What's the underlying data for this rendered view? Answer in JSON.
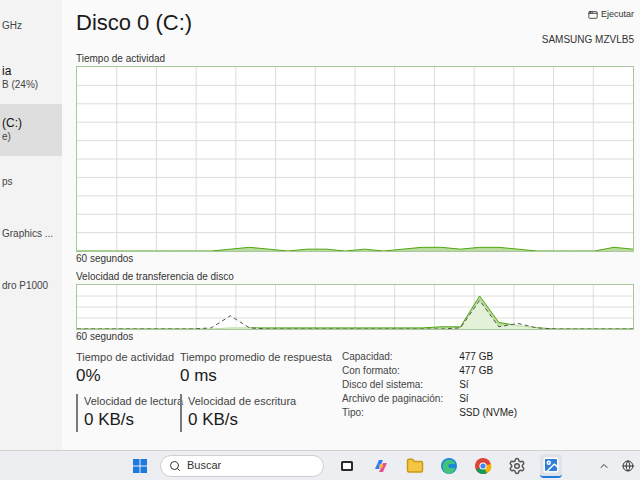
{
  "sidebar": {
    "items": [
      {
        "lines": [
          "GHz"
        ],
        "selected": false
      },
      {
        "lines": [
          "ia",
          "B (24%)"
        ],
        "selected": false
      },
      {
        "lines": [
          "(C:)",
          "e)"
        ],
        "selected": true
      },
      {
        "lines": [
          "ps"
        ],
        "selected": false
      },
      {
        "lines": [
          "Graphics ..."
        ],
        "selected": false
      },
      {
        "lines": [
          "dro P1000"
        ],
        "selected": false
      }
    ]
  },
  "header": {
    "title": "Disco 0 (C:)",
    "action": "Ejecutar",
    "model": "SAMSUNG MZVLB5"
  },
  "activity_chart": {
    "label": "Tiempo de actividad",
    "time_label": "60 segundos",
    "max": 100,
    "series": [
      {
        "values": [
          0,
          0,
          0,
          0,
          0,
          0,
          0,
          0,
          1,
          2,
          1,
          0,
          1,
          1,
          0,
          1,
          0,
          1,
          2,
          2,
          1,
          2,
          2,
          1,
          0,
          0,
          0,
          0,
          2,
          1
        ],
        "dashed": false
      }
    ]
  },
  "transfer_chart": {
    "label": "Velocidad de transferencia de disco",
    "time_label": "60 segundos",
    "max": 40,
    "series": [
      {
        "values": [
          0,
          0,
          0,
          0,
          0,
          0,
          0,
          0,
          1,
          1,
          1,
          1,
          1,
          1,
          1,
          1,
          1,
          1,
          1,
          2,
          2,
          30,
          6,
          3,
          1,
          0,
          0,
          0,
          0,
          0
        ],
        "dashed": false
      },
      {
        "values": [
          0,
          0,
          0,
          0,
          0,
          0,
          0,
          1,
          12,
          1,
          0,
          0,
          0,
          0,
          0,
          0,
          0,
          0,
          0,
          0,
          1,
          26,
          2,
          5,
          1,
          0,
          0,
          0,
          0,
          0
        ],
        "dashed": true
      }
    ]
  },
  "stats": [
    {
      "label": "Tiempo de actividad",
      "value": "0%",
      "kind": "plain"
    },
    {
      "label": "Tiempo promedio de respuesta",
      "value": "0 ms",
      "kind": "plain"
    },
    {
      "label": "Velocidad de lectura",
      "value": "0 KB/s",
      "kind": "legend"
    },
    {
      "label": "Velocidad de escritura",
      "value": "0 KB/s",
      "kind": "legend"
    }
  ],
  "properties": [
    {
      "label": "Capacidad:",
      "value": "477 GB"
    },
    {
      "label": "Con formato:",
      "value": "477 GB"
    },
    {
      "label": "Disco del sistema:",
      "value": "Sí"
    },
    {
      "label": "Archivo de paginación:",
      "value": "Sí"
    },
    {
      "label": "Tipo:",
      "value": "SSD (NVMe)"
    }
  ],
  "taskbar": {
    "search_placeholder": "Buscar",
    "apps": [
      {
        "kind": "taskview",
        "selected": false
      },
      {
        "kind": "copilot",
        "selected": false
      },
      {
        "kind": "explorer",
        "selected": false
      },
      {
        "kind": "edge",
        "selected": false
      },
      {
        "kind": "chrome",
        "selected": false
      },
      {
        "kind": "settings",
        "selected": false
      },
      {
        "kind": "photos",
        "selected": true
      }
    ]
  }
}
